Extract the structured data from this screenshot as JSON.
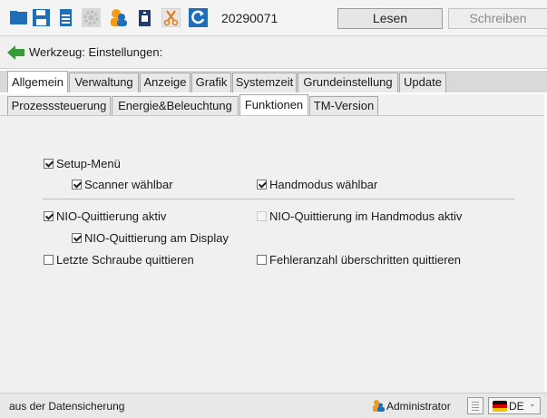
{
  "toolbar": {
    "icons": [
      "folder-icon",
      "save-icon",
      "print-icon",
      "gear-icon",
      "user-icon",
      "trash-icon",
      "cut-icon",
      "refresh-icon"
    ],
    "date": "20290071",
    "read_label": "Lesen",
    "write_label": "Schreiben"
  },
  "header": {
    "title": "Werkzeug: Einstellungen:"
  },
  "tabs": {
    "main": [
      "Allgemein",
      "Verwaltung",
      "Anzeige",
      "Grafik",
      "Systemzeit",
      "Grundeinstellung",
      "Update"
    ],
    "main_active": "Allgemein",
    "sub": [
      "Prozesssteuerung",
      "Energie&Beleuchtung",
      "Funktionen",
      "TM-Version"
    ],
    "sub_active": "Funktionen"
  },
  "settings": {
    "setup_menu": {
      "label": "Setup-Menü",
      "checked": true
    },
    "scanner": {
      "label": "Scanner wählbar",
      "checked": true
    },
    "handmode": {
      "label": "Handmodus wählbar",
      "checked": true
    },
    "nio_active": {
      "label": "NIO-Quittierung aktiv",
      "checked": true
    },
    "nio_handmode": {
      "label": "NIO-Quittierung im Handmodus aktiv",
      "checked": false,
      "disabled": true
    },
    "nio_display": {
      "label": "NIO-Quittierung am Display",
      "checked": true
    },
    "last_screw": {
      "label": "Letzte Schraube quittieren",
      "checked": false
    },
    "error_count": {
      "label": "Fehleranzahl überschritten quittieren",
      "checked": false
    }
  },
  "status": {
    "text": "aus der Datensicherung",
    "user": "Administrator",
    "language": "DE"
  },
  "colors": {
    "toolbar_blue": "#1e6fb8",
    "back_green": "#3a9a3a",
    "user_orange": "#f29b18"
  }
}
